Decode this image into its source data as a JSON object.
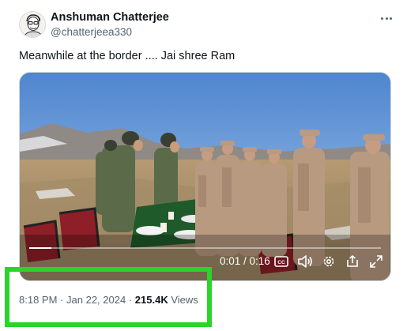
{
  "author": {
    "name": "Anshuman Chatterjee",
    "handle": "@chatterjeea330",
    "avatar_icon": "portrait-sketch-icon"
  },
  "more_icon": "more-horizontal-icon",
  "tweet": {
    "text": "Meanwhile at the border .... Jai shree Ram"
  },
  "video": {
    "time": "0:01 / 0:16",
    "progress": 0.0625,
    "controls": [
      "closed-captions-icon",
      "volume-icon",
      "settings-icon",
      "share-out-icon",
      "fullscreen-icon"
    ]
  },
  "meta": {
    "time": "8:18 PM",
    "sep1": "·",
    "date": "Jan 22, 2024",
    "sep2": "·",
    "views_count": "215.4K",
    "views_label": "Views"
  },
  "colors": {
    "highlight": "#2ad42a",
    "text_primary": "#0f1419",
    "text_secondary": "#536471"
  }
}
